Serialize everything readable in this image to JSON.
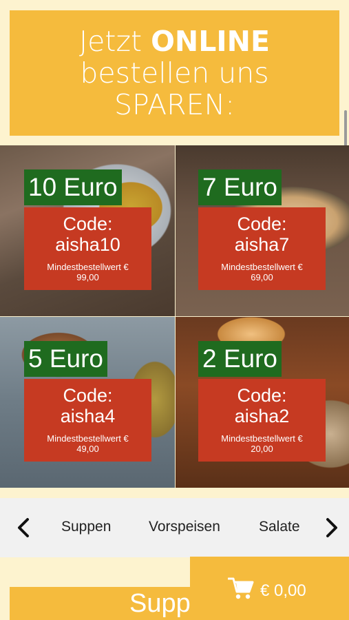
{
  "banner": {
    "line1_light": "Jetzt ",
    "line1_bold": "ONLINE",
    "line2": "bestellen uns",
    "line3": "SPAREN:"
  },
  "coupons": [
    {
      "amount": "10 Euro",
      "code_label": "Code:",
      "code": "aisha10",
      "min_label": "Mindestbestellwert €",
      "min_value": "99,00"
    },
    {
      "amount": "7 Euro",
      "code_label": "Code:",
      "code": "aisha7",
      "min_label": "Mindestbestellwert €",
      "min_value": "69,00"
    },
    {
      "amount": "5 Euro",
      "code_label": "Code:",
      "code": "aisha4",
      "min_label": "Mindestbestellwert €",
      "min_value": "49,00"
    },
    {
      "amount": "2 Euro",
      "code_label": "Code:",
      "code": "aisha2",
      "min_label": "Mindestbestellwert €",
      "min_value": "20,00"
    }
  ],
  "categories": {
    "items": [
      "Suppen",
      "Vorspeisen",
      "Salate"
    ],
    "prev_icon": "chevron-left-icon",
    "next_icon": "chevron-right-icon"
  },
  "section": {
    "title": "Suppen"
  },
  "cart": {
    "icon": "cart-icon",
    "total": "€ 0,00"
  },
  "colors": {
    "accent": "#f5bb3d",
    "amount_bg": "#1f6b1f",
    "code_bg": "#c63a22",
    "page_bg": "#fdf3cf"
  }
}
